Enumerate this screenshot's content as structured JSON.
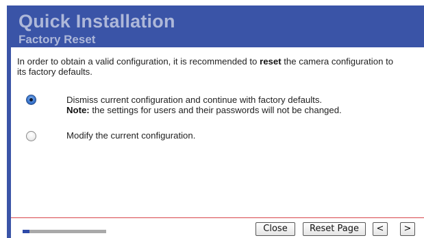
{
  "header": {
    "title": "Quick Installation",
    "subtitle": "Factory Reset"
  },
  "intro": {
    "text_before": "In order to obtain a valid configuration, it is recommended to ",
    "text_bold": "reset",
    "text_after": " the camera configuration to its factory defaults."
  },
  "options": [
    {
      "checked": true,
      "line1": "Dismiss current configuration and continue with factory defaults.",
      "note_label": "Note:",
      "note_text": " the settings for users and their passwords will not be changed."
    },
    {
      "checked": false,
      "line1": "Modify the current configuration."
    }
  ],
  "footer": {
    "progress_fraction": 0.08,
    "buttons": {
      "close": "Close",
      "reset_page": "Reset Page",
      "prev": "<",
      "next": ">"
    }
  },
  "colors": {
    "header_bg": "#3a54a7",
    "header_text": "#aeb8d9",
    "divider": "#d8454a",
    "progress_track": "#a9a9a9",
    "progress_fill": "#2e4aa8"
  }
}
